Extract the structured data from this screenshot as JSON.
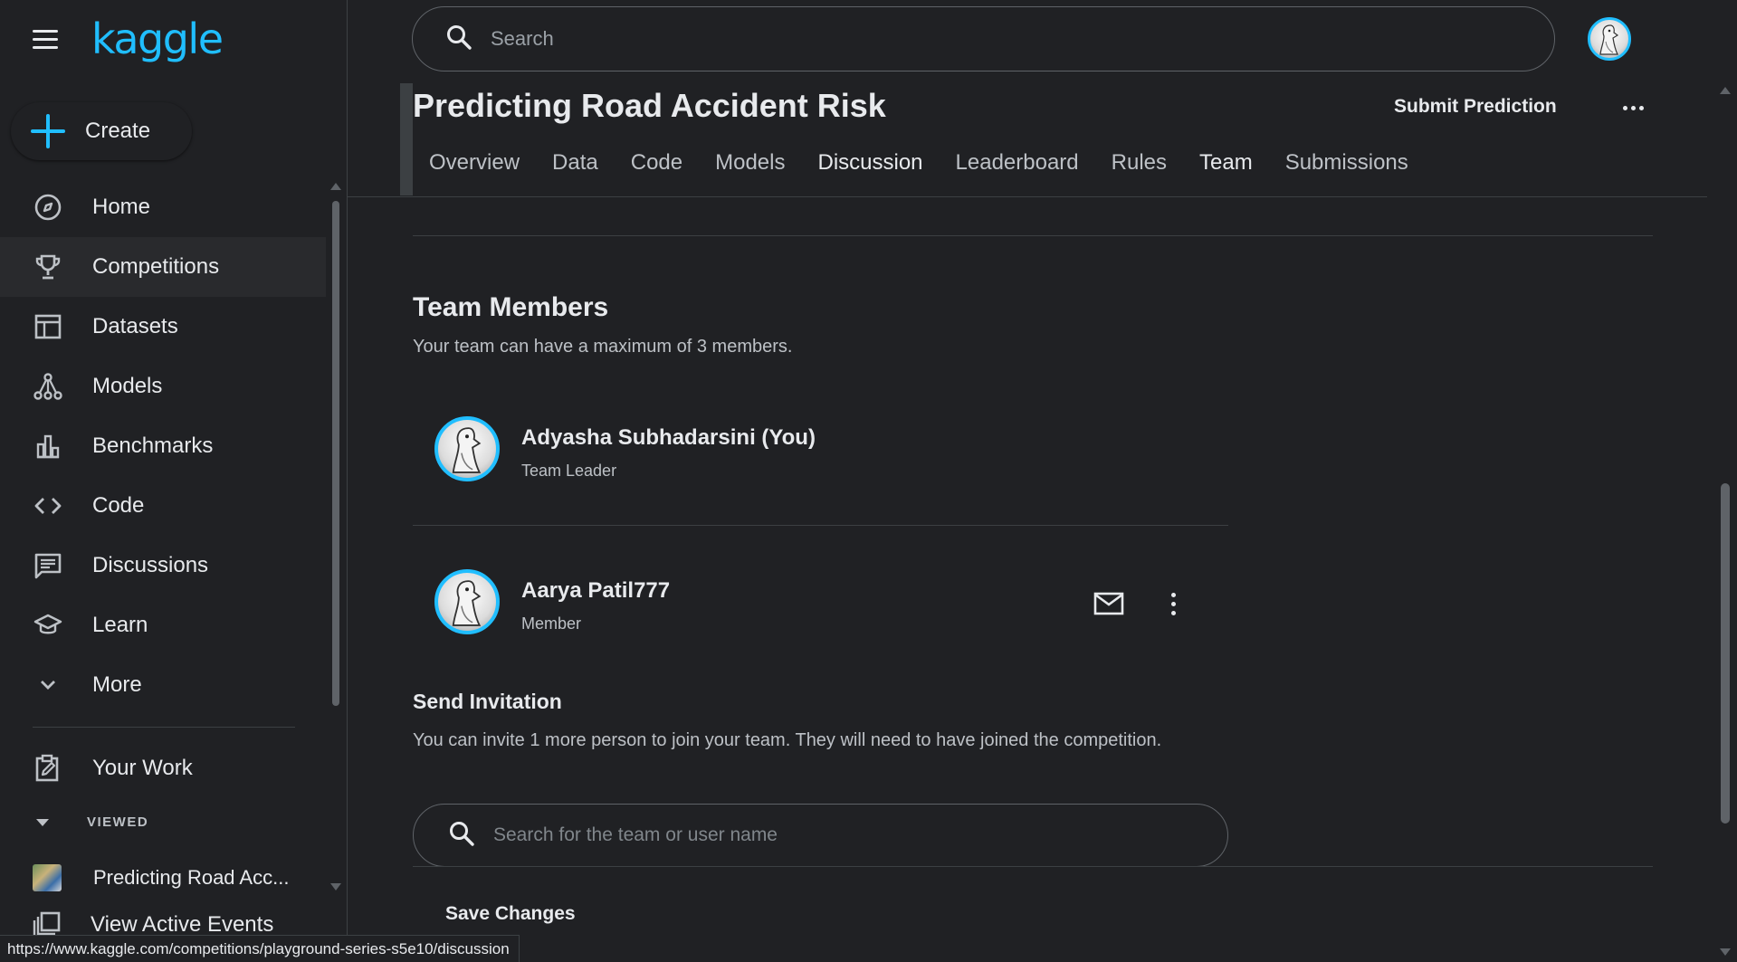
{
  "brand": {
    "logo_text": "kaggle",
    "accent_color": "#20beff"
  },
  "sidebar": {
    "create_label": "Create",
    "items": [
      {
        "label": "Home",
        "icon": "compass-icon"
      },
      {
        "label": "Competitions",
        "icon": "trophy-icon",
        "active": true
      },
      {
        "label": "Datasets",
        "icon": "table-icon"
      },
      {
        "label": "Models",
        "icon": "models-icon"
      },
      {
        "label": "Benchmarks",
        "icon": "bar-chart-icon"
      },
      {
        "label": "Code",
        "icon": "code-icon"
      },
      {
        "label": "Discussions",
        "icon": "discussion-icon"
      },
      {
        "label": "Learn",
        "icon": "graduation-cap-icon"
      },
      {
        "label": "More",
        "icon": "chevron-down-icon"
      }
    ],
    "your_work_label": "Your Work",
    "viewed_header": "VIEWED",
    "recent_item": "Predicting Road Acc...",
    "events_label": "View Active Events"
  },
  "search": {
    "placeholder": "Search"
  },
  "competition": {
    "title": "Predicting Road Accident Risk",
    "submit_label": "Submit Prediction",
    "tabs": [
      "Overview",
      "Data",
      "Code",
      "Models",
      "Discussion",
      "Leaderboard",
      "Rules",
      "Team",
      "Submissions"
    ]
  },
  "team": {
    "title": "Team Members",
    "subtitle": "Your team can have a maximum of 3 members.",
    "members": [
      {
        "name": "Adyasha Subhadarsini (You)",
        "role": "Team Leader"
      },
      {
        "name": "Aarya Patil777",
        "role": "Member"
      }
    ]
  },
  "invite": {
    "title": "Send Invitation",
    "description": "You can invite 1 more person to join your team. They will need to have joined the competition.",
    "search_placeholder": "Search for the team or user name",
    "save_label": "Save Changes"
  },
  "status_url": "https://www.kaggle.com/competitions/playground-series-s5e10/discussion"
}
